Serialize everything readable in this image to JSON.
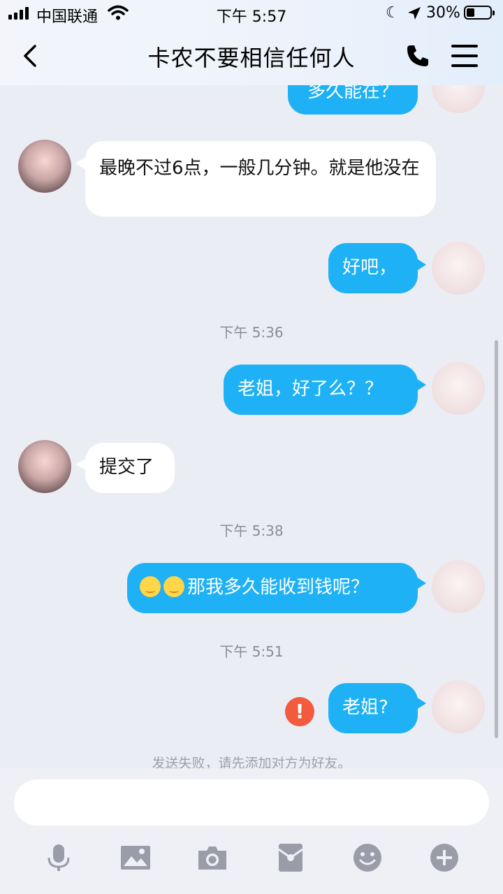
{
  "status_bar": {
    "carrier": "中国联通",
    "time": "下午 5:57",
    "battery_percent": "30%",
    "battery_level": 0.3
  },
  "nav": {
    "title": "卡农不要相信任何人",
    "icons": [
      "back-chevron-icon",
      "phone-icon",
      "menu-icon"
    ]
  },
  "messages": [
    {
      "side": "out",
      "text": "多久能在？",
      "partial": true
    },
    {
      "side": "in",
      "text": "最晚不过6点，一般几分钟。就是他没在"
    },
    {
      "side": "out",
      "text": "好吧，"
    },
    {
      "type": "time",
      "text": "下午 5:36"
    },
    {
      "side": "out",
      "text": "老姐，好了么？？"
    },
    {
      "side": "in",
      "text": "提交了"
    },
    {
      "type": "time",
      "text": "下午 5:38"
    },
    {
      "side": "out",
      "text": "那我多久能收到钱呢？",
      "emoji": [
        "relieved-face-emoji",
        "relieved-face-emoji"
      ]
    },
    {
      "type": "time",
      "text": "下午 5:51"
    },
    {
      "side": "out",
      "text": "老姐?",
      "failed": true
    }
  ],
  "failure_notice": "发送失败，请先添加对方为好友。",
  "composer": {
    "placeholder": "",
    "tools": [
      "microphone-icon",
      "image-icon",
      "camera-icon",
      "red-packet-icon",
      "emoji-icon",
      "plus-icon"
    ]
  },
  "colors": {
    "outgoing_bubble": "#1fb1f5",
    "incoming_bubble": "#ffffff",
    "background": "#ebedf5",
    "error_badge": "#f35b3e",
    "tool_icon": "#9a9ca8"
  }
}
